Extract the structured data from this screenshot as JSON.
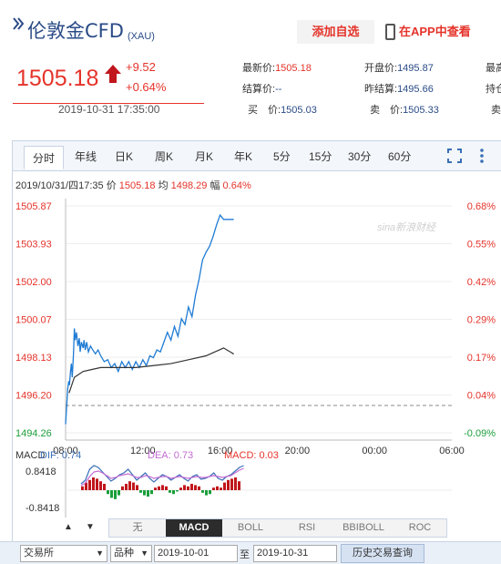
{
  "header": {
    "title": "伦敦金CFD",
    "code": "(XAU)",
    "watch_label": "添加自选",
    "app_label": "在APP中查看"
  },
  "quote": {
    "price": "1505.18",
    "change": "+9.52",
    "change_pct": "+0.64%",
    "timestamp": "2019-10-31 17:35:00",
    "fields": [
      {
        "label": "最新价:",
        "value": "1505.18"
      },
      {
        "label": "开盘价:",
        "value": "1495.87"
      },
      {
        "label": "最高",
        "value": ""
      },
      {
        "label": "结算价:",
        "value": "--"
      },
      {
        "label": "昨结算:",
        "value": "1495.66"
      },
      {
        "label": "持仓",
        "value": ""
      },
      {
        "label": "买　价:",
        "value": "1505.03"
      },
      {
        "label": "卖　价:",
        "value": "1505.33"
      },
      {
        "label": "卖",
        "value": ""
      }
    ]
  },
  "tabs": [
    "分时",
    "年线",
    "日K",
    "周K",
    "月K",
    "年K",
    "5分",
    "15分",
    "30分",
    "60分"
  ],
  "info_line": {
    "date": "2019/10/31/四17:35",
    "price_label": "价",
    "price": "1505.18",
    "avg_label": "均",
    "avg": "1498.29",
    "amp_label": "幅",
    "amp": "0.64%"
  },
  "watermark": "sina新浪财经",
  "chart_data": {
    "type": "line",
    "y_left_ticks": [
      "1505.87",
      "1503.93",
      "1502.00",
      "1500.07",
      "1498.13",
      "1496.20",
      "1494.26"
    ],
    "y_right_ticks": [
      "0.68%",
      "0.55%",
      "0.42%",
      "0.29%",
      "0.17%",
      "0.04%",
      "-0.09%"
    ],
    "x_ticks": [
      "08:00",
      "12:00",
      "16:00",
      "20:00",
      "00:00",
      "06:00"
    ],
    "ylim": [
      1494.26,
      1505.87
    ],
    "prev_close": 1495.66,
    "series": [
      {
        "name": "价",
        "color": "#1f7bd4",
        "x": [
          0,
          0.06,
          0.12,
          0.18,
          0.22,
          0.28,
          0.33,
          0.38,
          0.45,
          0.5,
          0.55,
          0.62,
          0.7,
          0.78,
          0.83,
          0.9,
          1.0,
          1.05,
          1.12,
          1.2,
          1.3,
          1.42,
          1.55,
          1.7,
          1.85,
          2.0,
          2.2,
          2.4,
          2.6,
          2.8,
          3.0,
          3.2,
          3.4,
          3.6,
          3.8,
          4.0,
          4.2,
          4.4,
          4.6,
          4.8,
          5.0,
          5.2,
          5.4,
          5.6,
          5.8,
          6.0,
          6.2,
          6.4,
          6.6,
          6.8,
          7.0,
          7.2,
          7.4,
          7.6,
          7.8,
          8.0,
          8.2,
          8.4,
          8.6,
          8.8,
          9.0,
          9.1,
          9.2,
          9.3,
          9.4,
          9.5,
          9.58
        ],
        "y": [
          1494.7,
          1495.6,
          1496.5,
          1496.9,
          1496.7,
          1497.4,
          1497.8,
          1497.1,
          1498.3,
          1499.6,
          1499.0,
          1499.4,
          1498.7,
          1499.1,
          1498.4,
          1498.9,
          1498.6,
          1499.0,
          1498.5,
          1498.9,
          1498.4,
          1498.7,
          1498.5,
          1498.3,
          1498.5,
          1498.2,
          1497.9,
          1498.0,
          1497.6,
          1497.8,
          1497.4,
          1497.9,
          1497.6,
          1497.9,
          1497.5,
          1497.9,
          1497.6,
          1498.0,
          1497.7,
          1498.2,
          1498.1,
          1498.5,
          1498.4,
          1498.9,
          1499.4,
          1499.0,
          1499.7,
          1499.2,
          1500.1,
          1499.8,
          1500.7,
          1500.2,
          1501.3,
          1502.1,
          1503.1,
          1503.5,
          1503.8,
          1504.3,
          1504.9,
          1505.4,
          1505.18,
          1505.18,
          1505.18,
          1505.18,
          1505.18,
          1505.18,
          1505.18
        ]
      },
      {
        "name": "均",
        "color": "#333333",
        "x": [
          0.2,
          0.5,
          1.0,
          1.5,
          2.0,
          3.0,
          4.0,
          5.0,
          6.0,
          7.0,
          8.0,
          9.0,
          9.58
        ],
        "y": [
          1496.3,
          1497.1,
          1497.4,
          1497.5,
          1497.6,
          1497.6,
          1497.6,
          1497.7,
          1497.8,
          1498.0,
          1498.2,
          1498.6,
          1498.29
        ]
      }
    ]
  },
  "macd": {
    "label": "MACD",
    "dif_label": "DIF: 0.74",
    "dea_label": "DEA: 0.73",
    "macd_label": "MACD: 0.03",
    "y_top": "0.8418",
    "y_bottom": "-0.8418"
  },
  "indicator_tabs": [
    "无",
    "MACD",
    "BOLL",
    "RSI",
    "BBIBOLL",
    "ROC"
  ],
  "arrow_up": "▲",
  "arrow_down": "▼",
  "form": {
    "exchange": "交易所",
    "variety": "品种",
    "date_from": "2019-10-01",
    "to_label": "至",
    "date_to": "2019-10-31",
    "query": "历史交易查询"
  },
  "colors": {
    "up": "#e5332a",
    "brand": "#2a4b87",
    "price_line": "#1f7bd4"
  }
}
